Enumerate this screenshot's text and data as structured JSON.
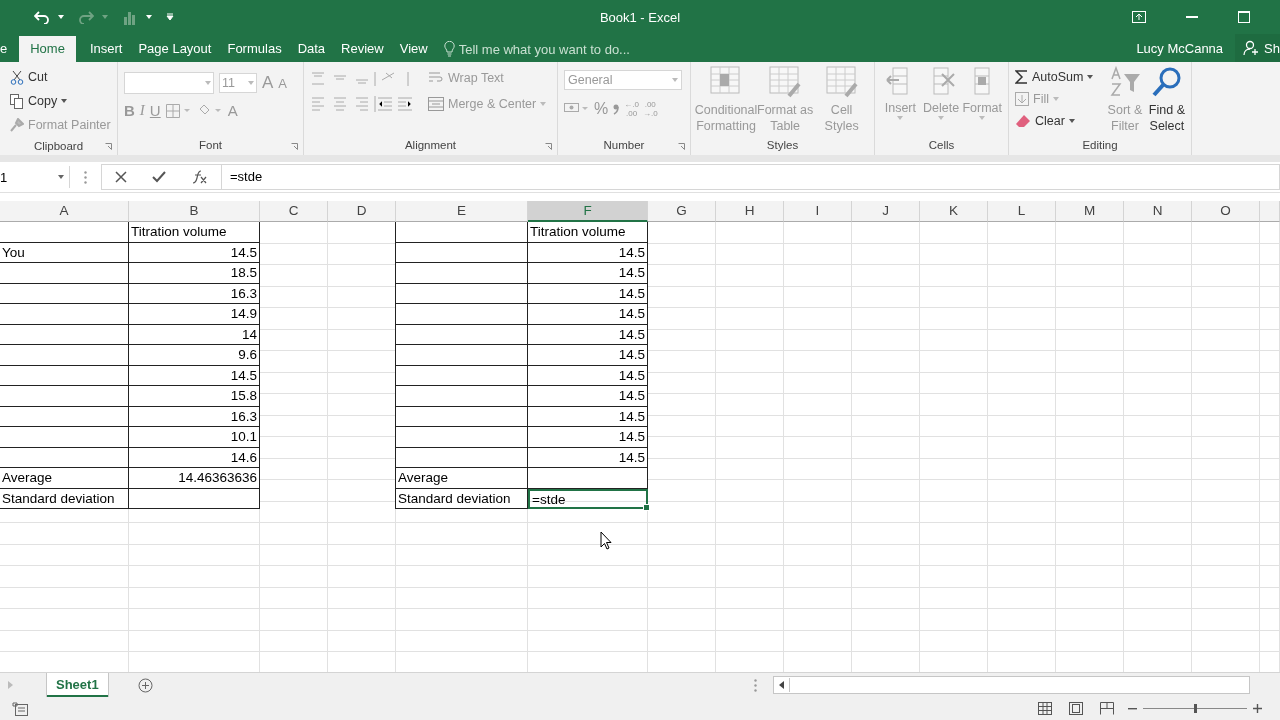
{
  "title_bar": {
    "title": "Book1 - Excel"
  },
  "ribbon_tabs": [
    {
      "label": "e",
      "selected": false
    },
    {
      "label": "Home",
      "selected": true
    },
    {
      "label": "Insert",
      "selected": false
    },
    {
      "label": "Page Layout",
      "selected": false
    },
    {
      "label": "Formulas",
      "selected": false
    },
    {
      "label": "Data",
      "selected": false
    },
    {
      "label": "Review",
      "selected": false
    },
    {
      "label": "View",
      "selected": false
    }
  ],
  "tell_me": {
    "placeholder": "Tell me what you want to do..."
  },
  "account": {
    "user": "Lucy McCanna",
    "share": "Sh"
  },
  "clipboard": {
    "label": "Clipboard",
    "items": [
      {
        "label": "Cut",
        "disabled": false,
        "kind": "cut"
      },
      {
        "label": "Copy",
        "disabled": false,
        "kind": "copy"
      },
      {
        "label": "Format Painter",
        "disabled": true,
        "kind": "painter"
      }
    ]
  },
  "font": {
    "label": "Font",
    "size": "11",
    "grow": "A",
    "shrink": "A",
    "bold": "B",
    "italic": "I",
    "underline": "U",
    "font_color": "A"
  },
  "alignment": {
    "label": "Alignment",
    "wrap_text": "Wrap Text",
    "merge": "Merge & Center"
  },
  "number": {
    "label": "Number",
    "format": "General",
    "percent": "%",
    "increase_decimal": [
      "←.0",
      ".00"
    ],
    "decrease_decimal": [
      ".00",
      "→.0"
    ]
  },
  "styles": {
    "label": "Styles",
    "items": [
      {
        "lines": [
          "Conditional",
          "Formatting"
        ]
      },
      {
        "lines": [
          "Format as",
          "Table"
        ]
      },
      {
        "lines": [
          "Cell",
          "Styles"
        ]
      }
    ]
  },
  "cells": {
    "label": "Cells",
    "items": [
      "Insert",
      "Delete",
      "Format"
    ]
  },
  "editing": {
    "label": "Editing",
    "items": [
      {
        "label": "AutoSum",
        "disabled": false,
        "kind": "autosum"
      },
      {
        "label": "Fill",
        "disabled": true,
        "kind": "fill"
      },
      {
        "label": "Clear",
        "disabled": false,
        "kind": "clear"
      }
    ],
    "sort": {
      "lines": [
        "Sort &",
        "Filter"
      ],
      "disabled": true
    },
    "find": {
      "lines": [
        "Find &",
        "Select"
      ],
      "disabled": false
    }
  },
  "formula_bar": {
    "name_box": "1",
    "formula": "=stde"
  },
  "columns": [
    {
      "label": "A",
      "selected": false
    },
    {
      "label": "B",
      "selected": false
    },
    {
      "label": "C",
      "selected": false
    },
    {
      "label": "D",
      "selected": false
    },
    {
      "label": "E",
      "selected": false
    },
    {
      "label": "F",
      "selected": true
    },
    {
      "label": "G",
      "selected": false
    },
    {
      "label": "H",
      "selected": false
    },
    {
      "label": "I",
      "selected": false
    },
    {
      "label": "J",
      "selected": false
    },
    {
      "label": "K",
      "selected": false
    },
    {
      "label": "L",
      "selected": false
    },
    {
      "label": "M",
      "selected": false
    },
    {
      "label": "N",
      "selected": false
    },
    {
      "label": "O",
      "selected": false
    }
  ],
  "left_table": {
    "header": "Titration volume",
    "rows": [
      {
        "label": "You",
        "value": "14.5"
      },
      {
        "value": "18.5"
      },
      {
        "value": "16.3"
      },
      {
        "value": "14.9"
      },
      {
        "value": "14"
      },
      {
        "value": "9.6"
      },
      {
        "value": "14.5"
      },
      {
        "value": "15.8"
      },
      {
        "value": "16.3"
      },
      {
        "value": "10.1"
      },
      {
        "value": "14.6"
      },
      {
        "label": "Average",
        "value": "14.46363636"
      },
      {
        "label": "Standard deviation"
      }
    ]
  },
  "right_table": {
    "header": "Titration volume",
    "rows": [
      {
        "value": "14.5",
        "selected": false
      },
      {
        "value": "14.5",
        "selected": false
      },
      {
        "value": "14.5",
        "selected": false
      },
      {
        "value": "14.5",
        "selected": false
      },
      {
        "value": "14.5",
        "selected": false
      },
      {
        "value": "14.5",
        "selected": false
      },
      {
        "value": "14.5",
        "selected": false
      },
      {
        "value": "14.5",
        "selected": false
      },
      {
        "value": "14.5",
        "selected": false
      },
      {
        "value": "14.5",
        "selected": false
      },
      {
        "value": "14.5",
        "selected": false
      },
      {
        "label": "Average",
        "selected": false
      },
      {
        "label": "Standard deviation",
        "value": "=stde",
        "selected": true
      }
    ]
  },
  "sheet_tabs": [
    {
      "label": "Sheet1",
      "selected": true
    }
  ],
  "zoom": {
    "level": 0.5
  }
}
